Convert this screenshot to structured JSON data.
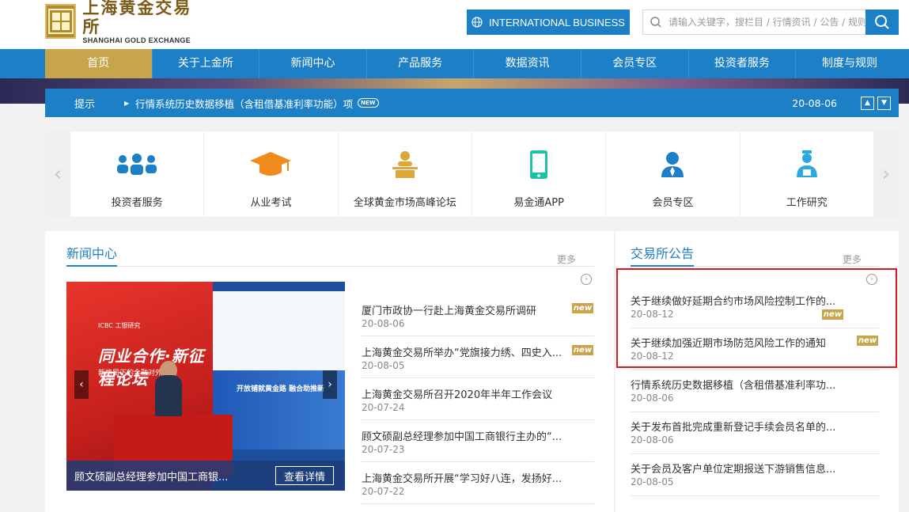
{
  "header": {
    "logo_cn": "上海黄金交易所",
    "logo_en": "SHANGHAI GOLD EXCHANGE",
    "intl_button": "INTERNATIONAL BUSINESS",
    "search_placeholder": "请输入关键字，搜栏目 / 行情资讯 / 公告 / 规则"
  },
  "nav": {
    "items": [
      {
        "label": "首页",
        "active": true
      },
      {
        "label": "关于上金所"
      },
      {
        "label": "新闻中心"
      },
      {
        "label": "产品服务"
      },
      {
        "label": "数据资讯"
      },
      {
        "label": "会员专区"
      },
      {
        "label": "投资者服务"
      },
      {
        "label": "制度与规则"
      }
    ]
  },
  "notice": {
    "label": "提示",
    "text": "行情系统历史数据移植（含租借基准利率功能）项",
    "badge": "NEW",
    "date": "20-08-06"
  },
  "quick_links": [
    {
      "label": "投资者服务",
      "icon": "investors-group-icon"
    },
    {
      "label": "从业考试",
      "icon": "graduation-cap-icon"
    },
    {
      "label": "全球黄金市场高峰论坛",
      "icon": "podium-speaker-icon"
    },
    {
      "label": "易金通APP",
      "icon": "mobile-phone-icon"
    },
    {
      "label": "会员专区",
      "icon": "member-user-icon"
    },
    {
      "label": "工作研究",
      "icon": "researcher-icon"
    }
  ],
  "news": {
    "title": "新闻中心",
    "more": "更多",
    "photo": {
      "caption": "顾文硕副总经理参加中国工商银...",
      "detail_button": "查看详情",
      "banner_main": "同业合作·新征程论坛",
      "banner_sub": "新格局下的金融对外开放",
      "banner_brand": "ICBC 工银研究",
      "screen_text": "开放铺就黄金路 融合助推新"
    },
    "items": [
      {
        "title": "厦门市政协一行赴上海黄金交易所调研",
        "date": "20-08-06",
        "new": true
      },
      {
        "title": "上海黄金交易所举办“党旗接力绣、四史入...",
        "date": "20-08-05",
        "new": true
      },
      {
        "title": "上海黄金交易所召开2020年半年工作会议",
        "date": "20-07-24",
        "new": false
      },
      {
        "title": "顾文硕副总经理参加中国工商银行主办的“...",
        "date": "20-07-23",
        "new": false
      },
      {
        "title": "上海黄金交易所开展“学习好八连，发扬好...",
        "date": "20-07-22",
        "new": false
      }
    ],
    "new_label": "new"
  },
  "announcements": {
    "title": "交易所公告",
    "more": "更多",
    "items": [
      {
        "title": "关于继续做好延期合约市场风险控制工作的...",
        "date": "20-08-12",
        "new": true
      },
      {
        "title": "关于继续加强近期市场防范风险工作的通知",
        "date": "20-08-12",
        "new": true
      },
      {
        "title": "行情系统历史数据移植（含租借基准利率功...",
        "date": "20-08-06",
        "new": false
      },
      {
        "title": "关于发布首批完成重新登记手续会员名单的...",
        "date": "20-08-06",
        "new": false
      },
      {
        "title": "关于会员及客户单位定期报送下游销售信息...",
        "date": "20-08-05",
        "new": false
      }
    ],
    "new_label": "new"
  },
  "colors": {
    "brand_blue": "#1d7fc5",
    "gold": "#c8a54a",
    "highlight_red": "#d9191c"
  }
}
